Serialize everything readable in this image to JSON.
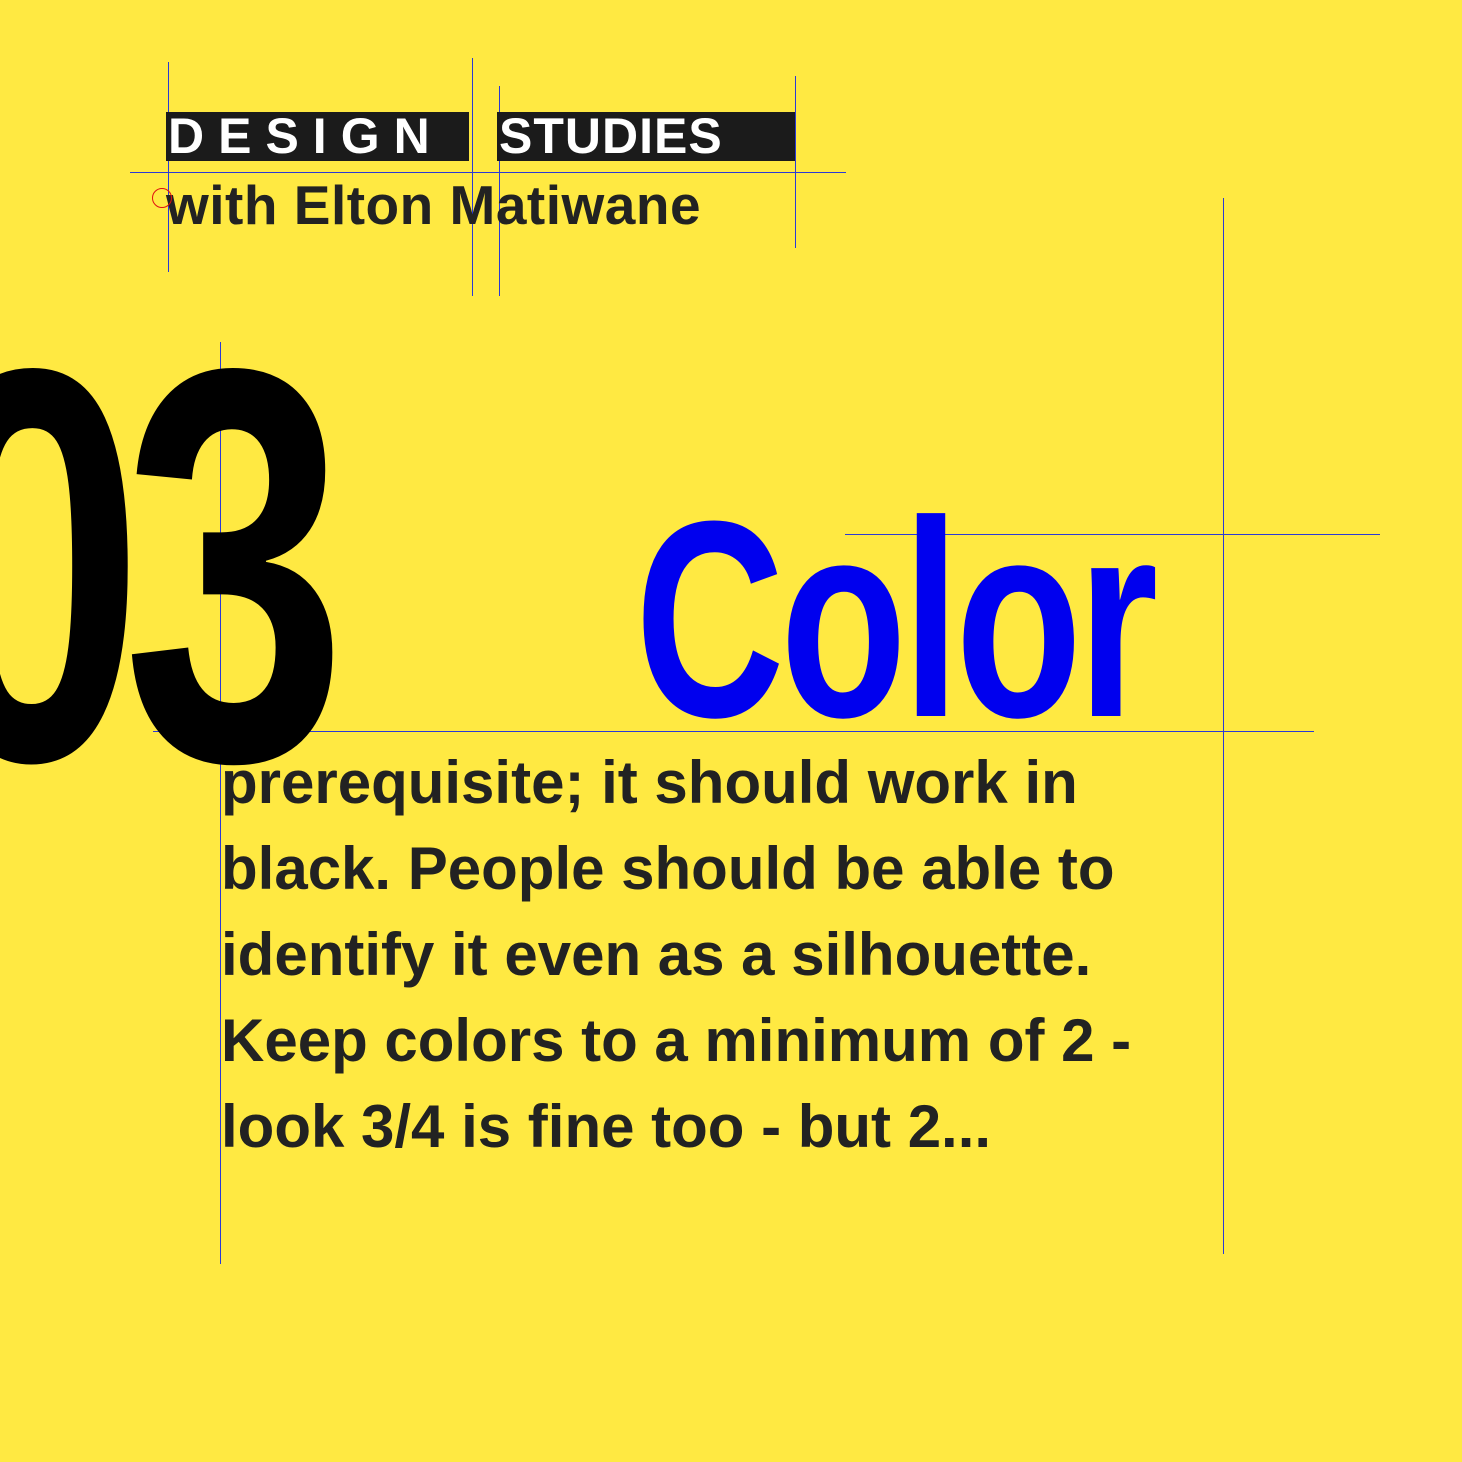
{
  "header": {
    "title_word_1": "DESIGN",
    "title_word_2": "STUDIES",
    "subtitle": "with Elton Matiwane"
  },
  "number": "03",
  "heading": "Color",
  "body": {
    "lines": [
      "prerequisite; it should work in",
      "black. People should be able to",
      "identify it even as a silhouette.",
      "Keep colors to a minimum of 2 -",
      "look 3/4 is fine too - but 2..."
    ]
  },
  "colors": {
    "background": "#FFE942",
    "heading": "#0000EE",
    "text": "#222222",
    "number": "#000000",
    "guides": "#2B3AD6",
    "marker": "#E01010"
  }
}
